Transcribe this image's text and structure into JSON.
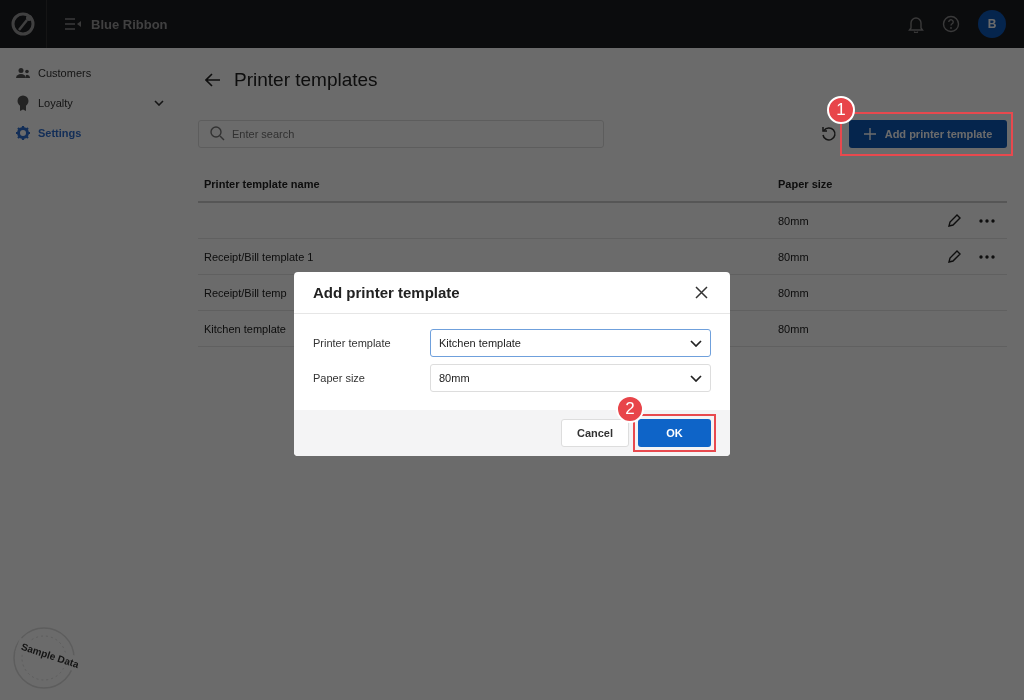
{
  "topbar": {
    "brand": "Blue Ribbon",
    "avatar": "B"
  },
  "sidebar": {
    "items": [
      {
        "label": "Customers",
        "selected": false,
        "expandable": false
      },
      {
        "label": "Loyalty",
        "selected": false,
        "expandable": true
      },
      {
        "label": "Settings",
        "selected": true,
        "expandable": false
      }
    ]
  },
  "page": {
    "title": "Printer templates",
    "search": {
      "placeholder": "Enter search"
    },
    "add_button": "Add printer template"
  },
  "table": {
    "columns": [
      "Printer template name",
      "Paper size"
    ],
    "rows": [
      {
        "paper_size": "80mm",
        "actions": true
      },
      {
        "name": "Receipt/Bill template 1",
        "paper_size": "80mm",
        "actions": true
      },
      {
        "name": "Receipt/Bill temp",
        "paper_size": "80mm",
        "actions": false
      },
      {
        "name": "Kitchen template",
        "paper_size": "80mm",
        "actions": false
      }
    ]
  },
  "dialog": {
    "title": "Add printer template",
    "fields": [
      {
        "label": "Printer template",
        "value": "Kitchen template",
        "focused": true
      },
      {
        "label": "Paper size",
        "value": "80mm",
        "focused": false
      }
    ],
    "buttons": [
      {
        "label": "Cancel",
        "kind": "secondary"
      },
      {
        "label": "OK",
        "kind": "primary"
      }
    ]
  },
  "callouts": [
    {
      "number": "1"
    },
    {
      "number": "2"
    }
  ],
  "sample_badge": "Sample Data"
}
